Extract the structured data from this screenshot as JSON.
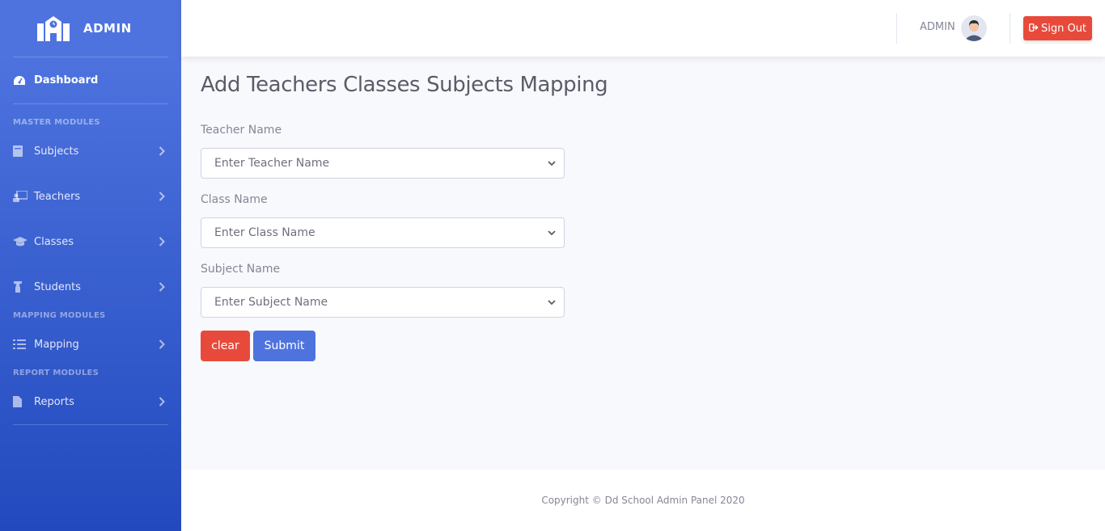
{
  "brand": {
    "name": "ADMIN",
    "icon": "school-icon"
  },
  "sidebar": {
    "dashboard": {
      "label": "Dashboard",
      "icon": "tachometer-icon"
    },
    "headings": [
      "MASTER MODULES",
      "MAPPING MODULES",
      "REPORT MODULES"
    ],
    "items": [
      {
        "label": "Subjects",
        "icon": "book-icon"
      },
      {
        "label": "Teachers",
        "icon": "chalkboard-teacher-icon"
      },
      {
        "label": "Classes",
        "icon": "graduation-cap-icon"
      },
      {
        "label": "Students",
        "icon": "user-student-icon"
      },
      {
        "label": "Mapping",
        "icon": "tasks-icon"
      },
      {
        "label": "Reports",
        "icon": "file-icon"
      }
    ]
  },
  "topbar": {
    "user_name": "ADMIN",
    "signout_label": "Sign Out"
  },
  "main": {
    "title": "Add Teachers Classes Subjects Mapping",
    "fields": [
      {
        "label": "Teacher Name",
        "selected": "Enter Teacher Name"
      },
      {
        "label": "Class Name",
        "selected": "Enter Class Name"
      },
      {
        "label": "Subject Name",
        "selected": "Enter Subject Name"
      }
    ],
    "clear_label": "clear",
    "submit_label": "Submit"
  },
  "footer": {
    "copyright": "Copyright © Dd School Admin Panel 2020"
  },
  "colors": {
    "primary": "#4e73df",
    "danger": "#e74a3b",
    "bg": "#f8f9fc"
  }
}
